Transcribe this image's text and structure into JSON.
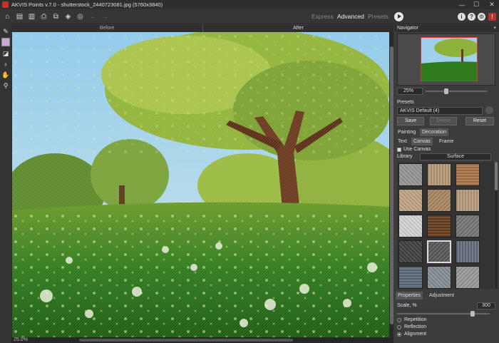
{
  "window": {
    "title": "AKVIS Points v.7.0 - shutterstock_2440723081.jpg (5760x3840)",
    "controls": [
      "—",
      "☐",
      "✕"
    ]
  },
  "toolbar": {
    "modes": [
      "Express",
      "Advanced",
      "Presets"
    ],
    "active_mode": "Advanced",
    "right_icons": [
      "i",
      "?",
      "⚙",
      "!"
    ]
  },
  "canvas": {
    "before_label": "Before",
    "after_label": "After",
    "zoom_status": "25.0%"
  },
  "navigator": {
    "title": "Navigator",
    "zoom": "25%",
    "zoom_level_fraction": 0.3
  },
  "presets": {
    "title": "Presets",
    "selected": "AKVIS Default (4)",
    "save_label": "Save",
    "delete_label": "Delete",
    "reset_label": "Reset"
  },
  "tabs": {
    "main": [
      "Painting",
      "Decoration"
    ],
    "main_active": "Decoration",
    "sub": [
      "Text",
      "Canvas",
      "Frame"
    ],
    "sub_active": "Canvas"
  },
  "canvas_settings": {
    "use_canvas_label": "Use Canvas",
    "use_canvas_checked": true,
    "library_label": "Library",
    "library_value": "Surface",
    "selected_texture_index": 10
  },
  "properties": {
    "tabs": [
      "Properties",
      "Adjustment"
    ],
    "active_tab": "Properties",
    "scale_label": "Scale, %",
    "scale_value": "300",
    "options": [
      "Repetition",
      "Reflection",
      "Alignment"
    ],
    "selected_option": "Alignment"
  },
  "colors": {
    "accent_red": "#b8332c",
    "panel_bg": "#3c3c3c",
    "app_bg": "#3a3a3a"
  }
}
